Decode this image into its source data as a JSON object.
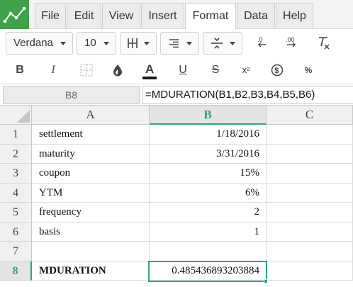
{
  "menu": {
    "tabs": [
      {
        "label": "File"
      },
      {
        "label": "Edit"
      },
      {
        "label": "View"
      },
      {
        "label": "Insert"
      },
      {
        "label": "Format"
      },
      {
        "label": "Data"
      },
      {
        "label": "Help"
      }
    ],
    "active_tab": "Format"
  },
  "toolbar": {
    "font_name": "Verdana",
    "font_size": "10",
    "icons": [
      "borders-icon",
      "align-icon",
      "valign-icon",
      "decrease-decimal-icon",
      "increase-decimal-icon",
      "clear-format-icon"
    ],
    "format_buttons": {
      "bold": "B",
      "italic": "I",
      "underline": "U",
      "strike": "S",
      "superscript": "x²",
      "currency": "$",
      "percent": "%"
    }
  },
  "formula_bar": {
    "cell_ref": "B8",
    "formula": "=MDURATION(B1,B2,B3,B4,B5,B6)"
  },
  "sheet": {
    "columns": [
      "A",
      "B",
      "C"
    ],
    "rows": [
      {
        "num": "1",
        "a": "settlement",
        "b": "1/18/2016"
      },
      {
        "num": "2",
        "a": "maturity",
        "b": "3/31/2016"
      },
      {
        "num": "3",
        "a": "coupon",
        "b": "15%"
      },
      {
        "num": "4",
        "a": "YTM",
        "b": "6%"
      },
      {
        "num": "5",
        "a": "frequency",
        "b": "2"
      },
      {
        "num": "6",
        "a": "basis",
        "b": "1"
      },
      {
        "num": "7",
        "a": "",
        "b": ""
      },
      {
        "num": "8",
        "a": "MDURATION",
        "b": "0.485436893203884"
      }
    ],
    "selected_cell": "B8",
    "accent_color": "#2ea37c"
  }
}
